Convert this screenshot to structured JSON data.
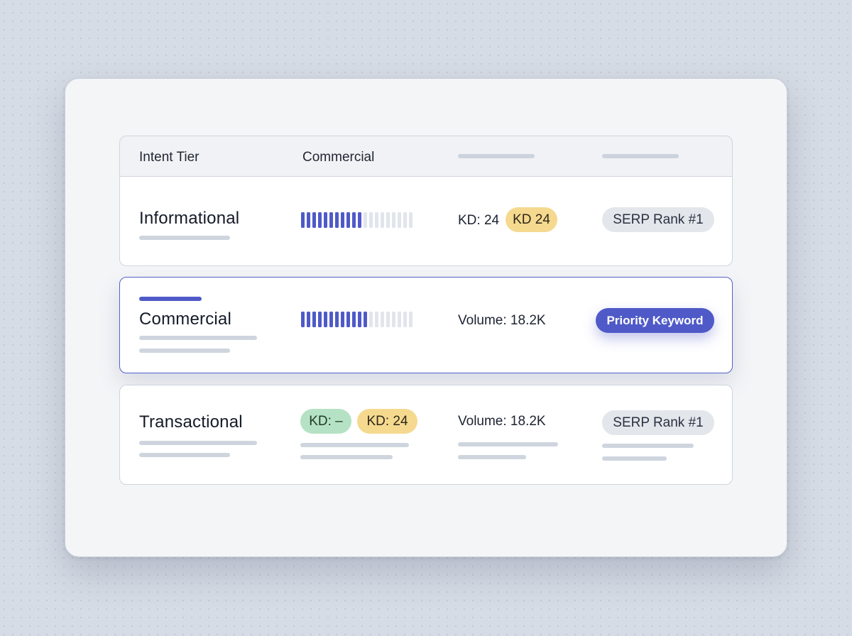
{
  "header": {
    "col_tier": "Intent Tier",
    "col_commercial": "Commercial"
  },
  "rows": [
    {
      "tier": "Informational",
      "intent_strength": 0.55,
      "kd_text": "KD: 24",
      "kd_badge": "KD 24",
      "serp_badge": "SERP Rank #1"
    },
    {
      "tier": "Commercial",
      "intent_strength": 0.6,
      "volume": "Volume: 18.2K",
      "priority_badge": "Priority Keyword"
    },
    {
      "tier": "Transactional",
      "kd_badge_green": "KD: –",
      "kd_badge_yellow": "KD: 24",
      "volume": "Volume: 18.2K",
      "serp_badge": "SERP Rank #1"
    }
  ],
  "colors": {
    "accent": "#4f5ac8",
    "kd_yellow": "#f5d98f",
    "kd_green": "#b5e2c4",
    "badge_grey": "#e3e6eb"
  }
}
